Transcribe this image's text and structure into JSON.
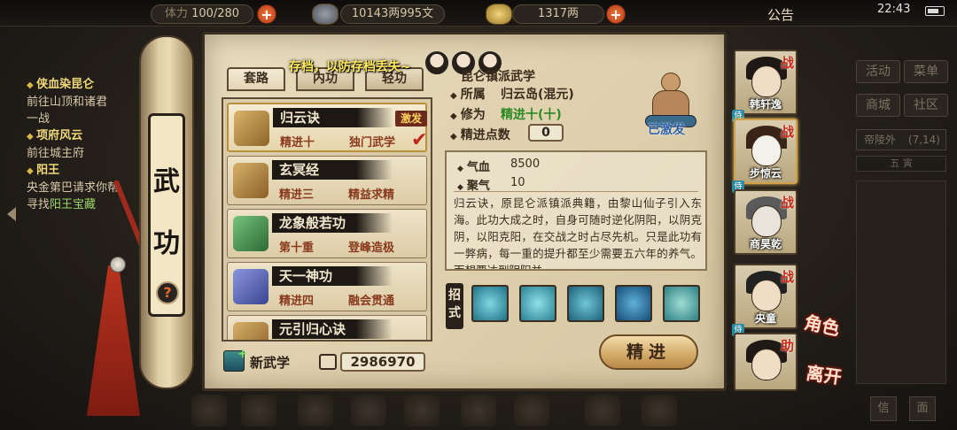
{
  "topbar": {
    "stamina": "100/280",
    "stamina_prefix": "体力",
    "silver": "10143两995文",
    "gold": "1317两",
    "announcement": "公告",
    "time": "22:43"
  },
  "quests": [
    {
      "title": "侠血染昆仑",
      "lines": [
        "前往山顶和诸君",
        "一战"
      ]
    },
    {
      "title": "项府风云",
      "lines": [
        "前往城主府"
      ]
    },
    {
      "title": "阳王",
      "lines": [
        "央金第巴请求你帮",
        "寻找"
      ],
      "highlight": "阳王宝藏"
    }
  ],
  "scroll": {
    "title_1": "武",
    "title_2": "功",
    "help": "?"
  },
  "save_banner": "存档，以防存档丢失~",
  "tabs": [
    {
      "label": "套路",
      "active": true
    },
    {
      "label": "内功",
      "active": false
    },
    {
      "label": "轻功",
      "active": false
    }
  ],
  "skills": [
    {
      "name": "归云诀",
      "level": "精进十",
      "tag": "独门武学",
      "badge": "激发",
      "selected": true,
      "icon_color": "#b08a4a"
    },
    {
      "name": "玄冥经",
      "level": "精进三",
      "tag": "精益求精",
      "badge": "",
      "selected": false,
      "icon_color": "#a98240"
    },
    {
      "name": "龙象般若功",
      "level": "第十重",
      "tag": "登峰造极",
      "badge": "",
      "selected": false,
      "icon_color": "#3f8a4a"
    },
    {
      "name": "天一神功",
      "level": "精进四",
      "tag": "融会贯通",
      "badge": "",
      "selected": false,
      "icon_color": "#5a66b0"
    },
    {
      "name": "元引归心诀",
      "level": "",
      "tag": "",
      "badge": "",
      "selected": false,
      "icon_color": "#a98240"
    }
  ],
  "new_skill": {
    "label": "新武学",
    "points": "2986970"
  },
  "detail": {
    "school_title": "昆仑镇派武学",
    "affiliation_label": "所属",
    "affiliation": "归云岛(混元)",
    "training_label": "修为",
    "training": "精进十(十)",
    "points_label": "精进点数",
    "points": "0",
    "activated": "已激发",
    "stats": [
      {
        "label": "气血",
        "value": "8500"
      },
      {
        "label": "聚气",
        "value": "10"
      }
    ],
    "description": "归云诀，原昆仑派镇派典籍，由黎山仙子引入东海。此功大成之时，自身可随时逆化阴阳，以阴克阴，以阳克阳，在交战之时占尽先机。只是此功有一弊病，每一重的提升都至少需要五六年的养气。而想要达到阴阳并",
    "moves_label": "招式",
    "move_colors": [
      "#2f9ab0",
      "#37a7b8",
      "#2a8aa2",
      "#236f9c",
      "#3ea2a8"
    ]
  },
  "train_button": "精进",
  "heroes": [
    {
      "name": "韩轩逸",
      "war": "战",
      "selected": false
    },
    {
      "name": "步惊云",
      "war": "战",
      "selected": true
    },
    {
      "name": "商昊乾",
      "war": "战",
      "selected": false
    },
    {
      "name": "央童",
      "war": "战",
      "selected": false
    },
    {
      "name": "",
      "war": "助",
      "selected": false
    }
  ],
  "hero_side_tag": "侍",
  "role_label": "角色",
  "leave_label": "离开",
  "right_menu": {
    "items": [
      "活动",
      "菜单",
      "商城",
      "社区"
    ],
    "location": "帝陵外",
    "coords": "(7,14)",
    "sub": "五 寅",
    "bottom": [
      "信",
      "面"
    ]
  }
}
